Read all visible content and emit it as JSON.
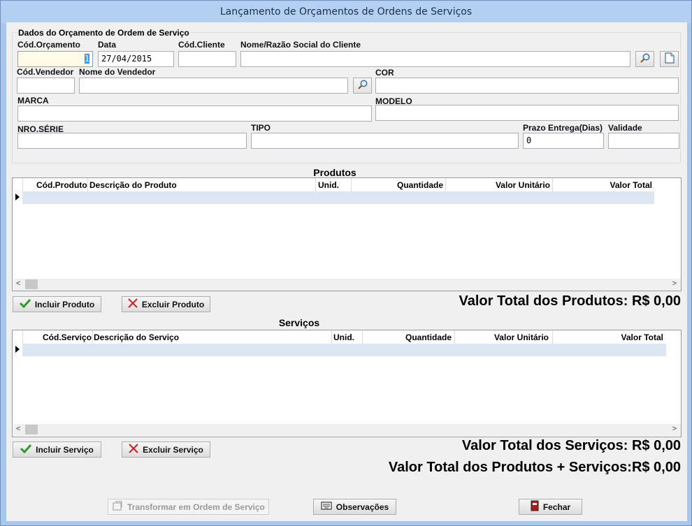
{
  "window": {
    "title": "Lançamento de Orçamentos de Ordens de Serviços"
  },
  "form": {
    "group_title": "Dados do Orçamento de Ordem de Serviço",
    "cod_orcamento": {
      "label": "Cód.Orçamento",
      "value": "1"
    },
    "data": {
      "label": "Data",
      "value": "27/04/2015"
    },
    "cod_cliente": {
      "label": "Cód.Cliente",
      "value": ""
    },
    "nome_cliente": {
      "label": "Nome/Razão Social do Cliente",
      "value": ""
    },
    "cod_vendedor": {
      "label": "Cód.Vendedor",
      "value": ""
    },
    "nome_vendedor": {
      "label": "Nome do Vendedor",
      "value": ""
    },
    "cor": {
      "label": "COR",
      "value": ""
    },
    "marca": {
      "label": "MARCA",
      "value": ""
    },
    "modelo": {
      "label": "MODELO",
      "value": ""
    },
    "nro_serie": {
      "label": "NRO.SÉRIE",
      "value": ""
    },
    "tipo": {
      "label": "TIPO",
      "value": ""
    },
    "prazo": {
      "label": "Prazo Entrega(Dias)",
      "value": "0"
    },
    "validade": {
      "label": "Validade",
      "value": ""
    }
  },
  "produtos": {
    "title": "Produtos",
    "columns": [
      "Cód.Produto",
      "Descrição do Produto",
      "Unid.",
      "Quantidade",
      "Valor Unitário",
      "Valor Total"
    ],
    "incluir_label": "Incluir Produto",
    "excluir_label": "Excluir Produto",
    "total_text": "Valor Total dos Produtos: R$ 0,00"
  },
  "servicos": {
    "title": "Serviços",
    "columns": [
      "Cód.Serviço",
      "Descrição do Serviço",
      "Unid.",
      "Quantidade",
      "Valor Unitário",
      "Valor Total"
    ],
    "incluir_label": "Incluir Serviço",
    "excluir_label": "Excluir Serviço",
    "total_text": "Valor Total dos Serviços: R$ 0,00"
  },
  "grand_total_text": "Valor Total dos Produtos + Serviços:R$ 0,00",
  "footer": {
    "transformar_label": "Transformar em Ordem de Serviço",
    "observacoes_label": "Observações",
    "fechar_label": "Fechar"
  },
  "colors": {
    "titlebar": "#b3cff2",
    "selected_row": "#dce7f3",
    "client": "#f0f0f0"
  },
  "icons": [
    "search-icon",
    "new-document-icon",
    "check-icon",
    "x-icon",
    "transform-icon",
    "keyboard-icon",
    "exit-door-icon"
  ]
}
